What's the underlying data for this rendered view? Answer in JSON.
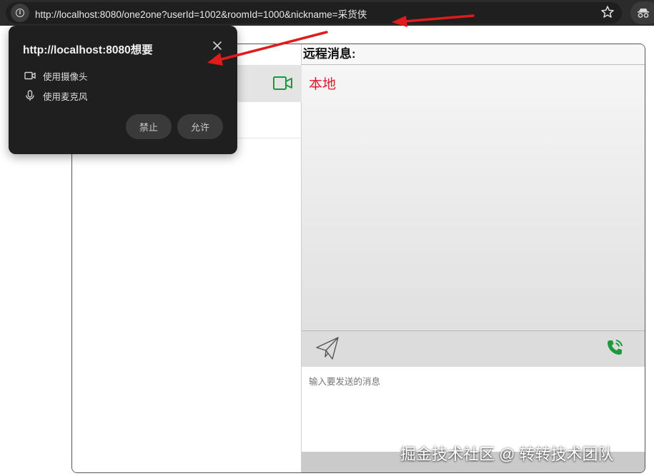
{
  "browser": {
    "url": "http://localhost:8080/one2one?userId=1002&roomId=1000&nickname=采货侠"
  },
  "permission_popup": {
    "title": "http://localhost:8080想要",
    "items": [
      {
        "icon": "camera-icon",
        "label": "使用摄像头"
      },
      {
        "icon": "microphone-icon",
        "label": "使用麦克风"
      }
    ],
    "block_label": "禁止",
    "allow_label": "允许"
  },
  "remote": {
    "title": "远程消息:",
    "local_label": "本地"
  },
  "composer": {
    "placeholder": "输入要发送的消息"
  },
  "watermark": "掘金技术社区 @ 转转技术团队",
  "colors": {
    "local_label": "#e0162b",
    "call_green": "#1a9a3a",
    "arrow_red": "#e01b1b"
  }
}
